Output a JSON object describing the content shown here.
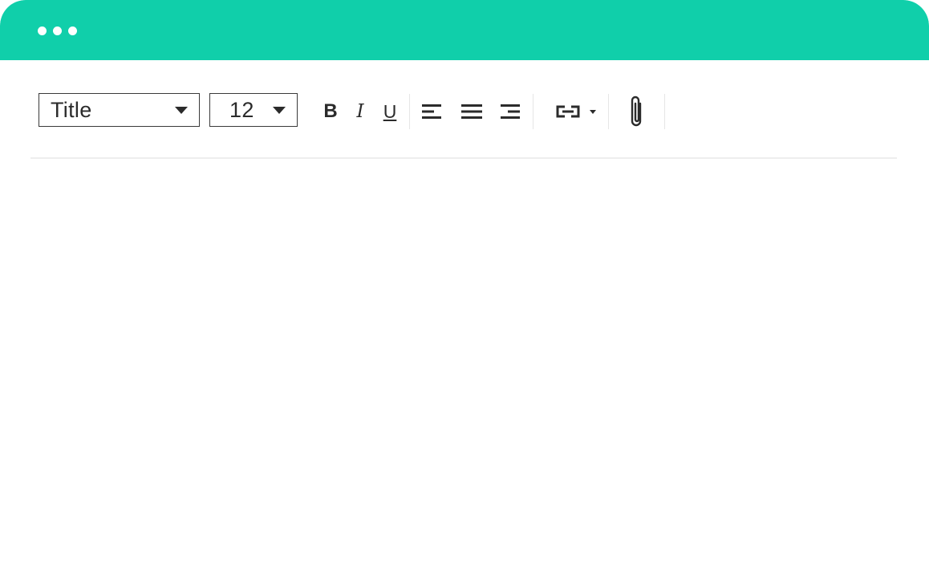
{
  "colors": {
    "titlebar": "#10cfaa",
    "text": "#2b2b2b"
  },
  "window": {
    "controls": [
      "dot",
      "dot",
      "dot"
    ]
  },
  "toolbar": {
    "style_select": {
      "value": "Title",
      "icon": "chevron-down-icon"
    },
    "size_select": {
      "value": "12",
      "icon": "chevron-down-icon"
    },
    "bold_label": "B",
    "italic_label": "I",
    "underline_label": "U",
    "icons": {
      "align_left": "align-left-icon",
      "align_center": "align-center-icon",
      "align_right": "align-right-icon",
      "link": "link-icon",
      "attach": "paperclip-icon"
    }
  },
  "editor": {
    "content": ""
  }
}
